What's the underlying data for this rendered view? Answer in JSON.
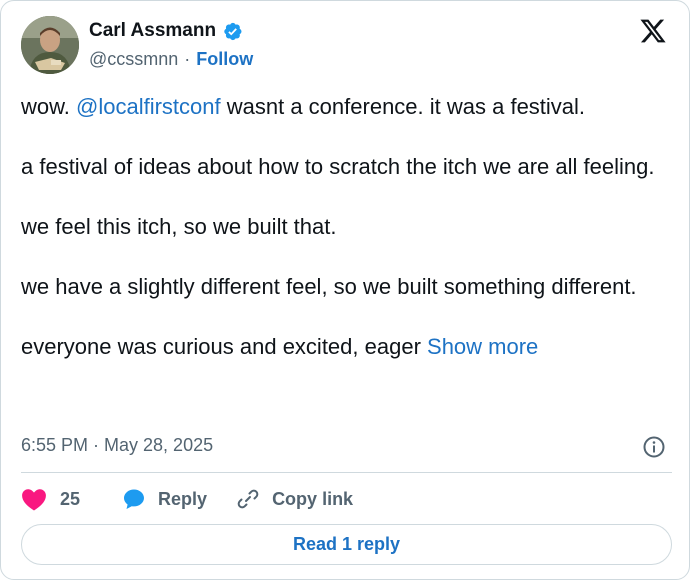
{
  "author": {
    "name": "Carl Assmann",
    "handle": "@ccssmnn",
    "separator": "·",
    "follow_label": "Follow",
    "verified": true
  },
  "tweet": {
    "line1_prefix": "wow. ",
    "mention": "@localfirstconf",
    "line1_suffix": " wasnt a conference. it was a festival.",
    "paragraph2": "a festival of ideas about how to scratch the itch we are all feeling.",
    "paragraph3": "we feel this itch, so we built that.",
    "paragraph4": "we have a slightly different feel, so we built something different.",
    "paragraph5": "everyone was curious and excited, eager ",
    "show_more_label": "Show more"
  },
  "meta": {
    "timestamp": "6:55 PM · May 28, 2025"
  },
  "actions": {
    "like_count": "25",
    "reply_label": "Reply",
    "copy_link_label": "Copy link"
  },
  "read_replies_label": "Read 1 reply",
  "colors": {
    "accent": "#1d72c4",
    "like": "#f91880",
    "verified": "#1d9bf0",
    "muted": "#536471",
    "border": "#cfd9de"
  },
  "icons": {
    "verified": "verified-badge-icon",
    "logo": "x-logo-icon",
    "info": "info-icon",
    "like": "heart-icon",
    "reply": "speech-bubble-icon",
    "copy": "link-icon"
  }
}
